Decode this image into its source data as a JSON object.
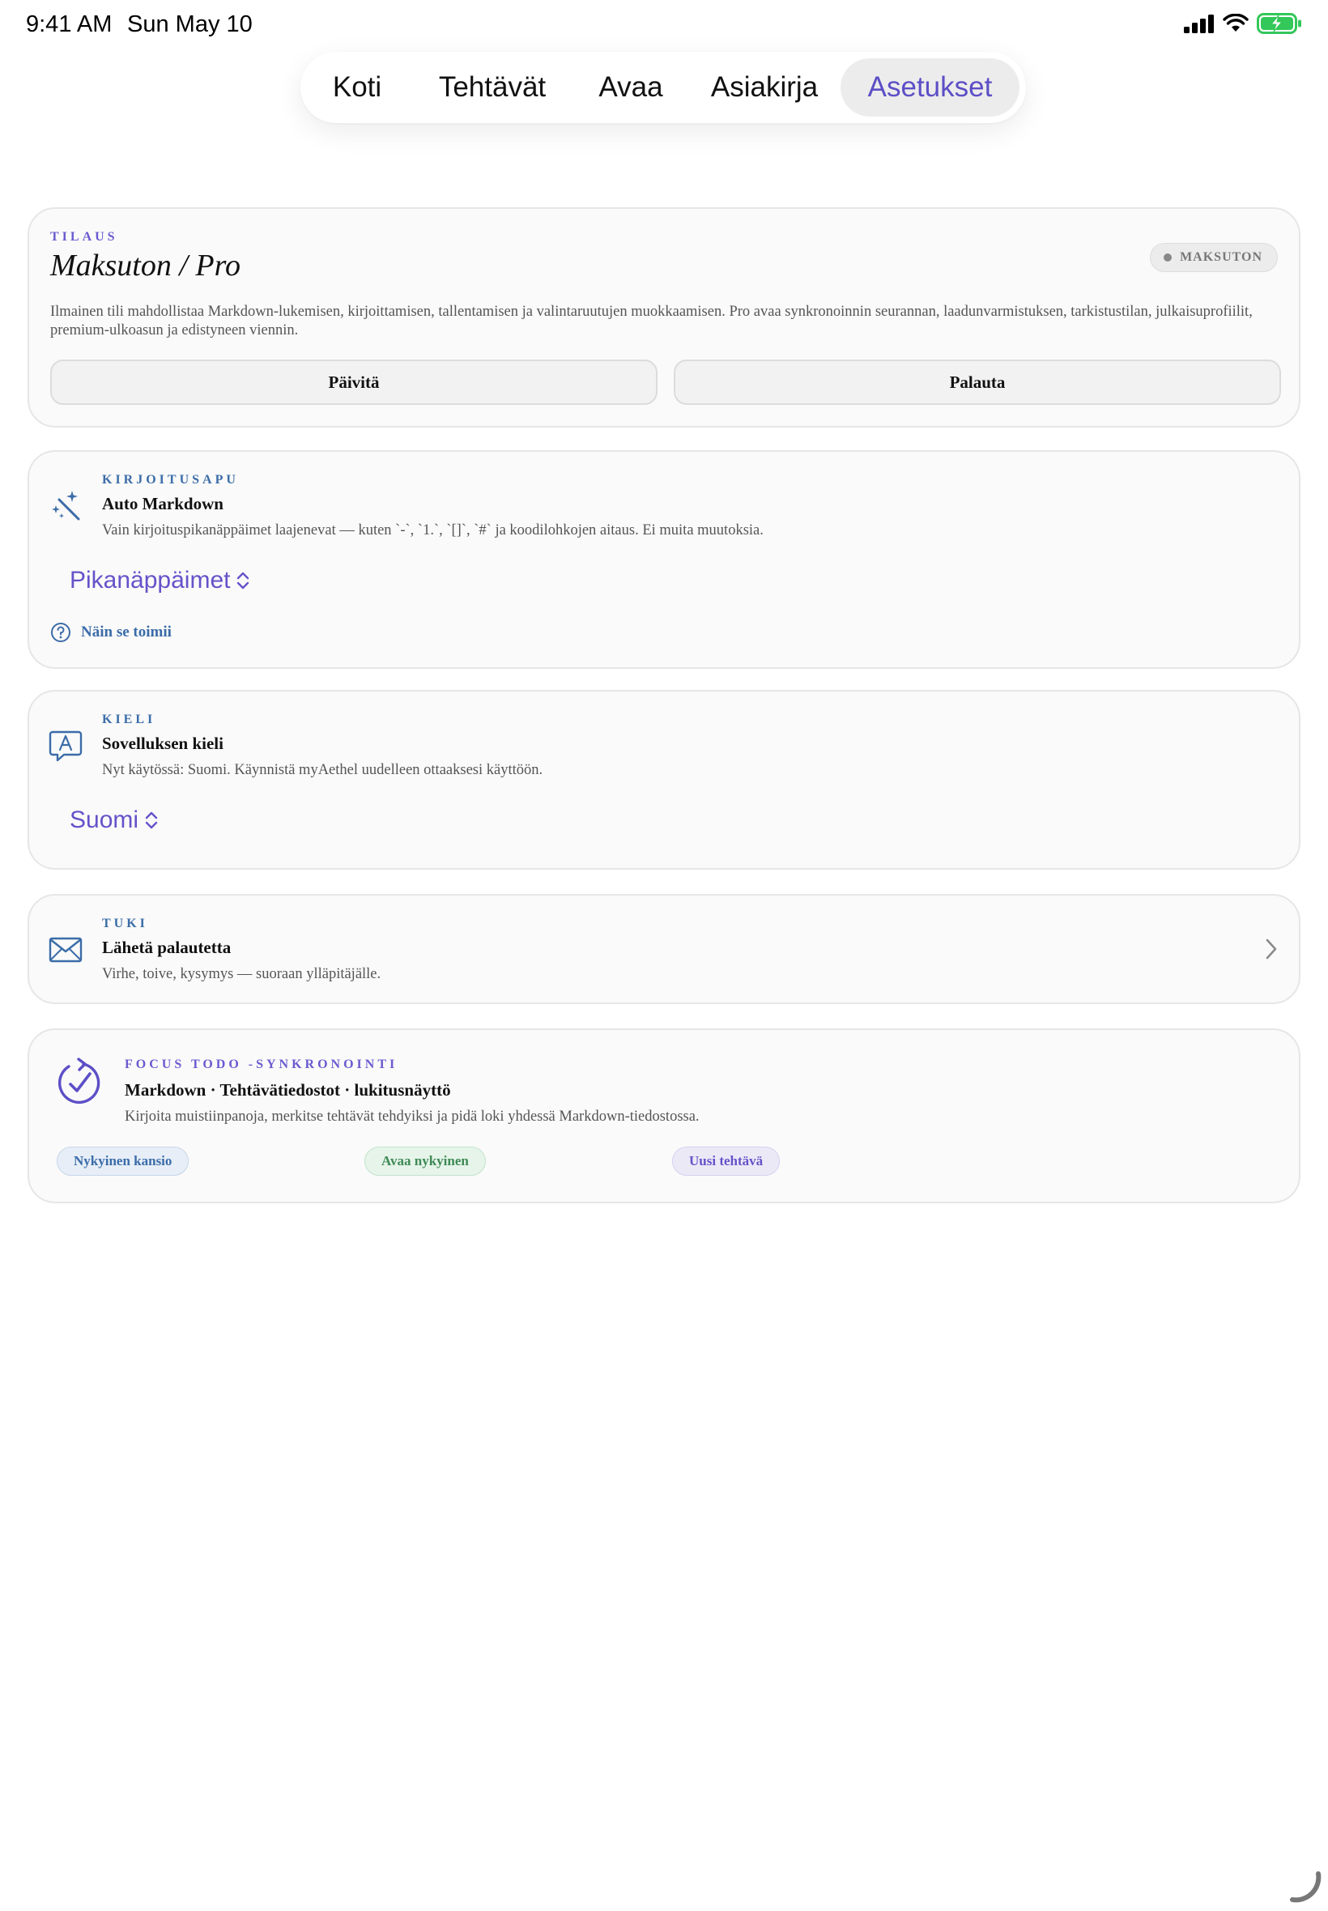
{
  "status": {
    "time": "9:41 AM",
    "date": "Sun May 10"
  },
  "tabs": [
    {
      "label": "Koti",
      "active": false
    },
    {
      "label": "Tehtävät",
      "active": false
    },
    {
      "label": "Avaa",
      "active": false
    },
    {
      "label": "Asiakirja",
      "active": false
    },
    {
      "label": "Asetukset",
      "active": true
    }
  ],
  "subscription": {
    "eyebrow": "TILAUS",
    "title": "Maksuton / Pro",
    "badge": "MAKSUTON",
    "description": "Ilmainen tili mahdollistaa Markdown-lukemisen, kirjoittamisen, tallentamisen ja valintaruutujen muokkaamisen. Pro avaa synkronoinnin seurannan, laadunvarmistuksen, tarkistustilan, julkaisuprofiilit, premium-ulkoasun ja edistyneen viennin.",
    "upgrade_label": "Päivitä",
    "restore_label": "Palauta"
  },
  "writing": {
    "eyebrow": "KIRJOITUSAPU",
    "title": "Auto Markdown",
    "description": "Vain kirjoituspikanäppäimet laajenevat — kuten `-`, `1.`, `[]`, `#` ja koodilohkojen aitaus. Ei muita muutoksia.",
    "picker_value": "Pikanäppäimet",
    "help_label": "Näin se toimii"
  },
  "language": {
    "eyebrow": "KIELI",
    "title": "Sovelluksen kieli",
    "description": "Nyt käytössä: Suomi. Käynnistä myAethel uudelleen ottaaksesi käyttöön.",
    "picker_value": "Suomi"
  },
  "support": {
    "eyebrow": "TUKI",
    "title": "Lähetä palautetta",
    "description": "Virhe, toive, kysymys — suoraan ylläpitäjälle."
  },
  "focus": {
    "eyebrow": "FOCUS TODO -SYNKRONOINTI",
    "title": "Markdown · Tehtävätiedostot · lukitusnäyttö",
    "description": "Kirjoita muistiinpanoja, merkitse tehtävät tehdyiksi ja pidä loki yhdessä Markdown-tiedostossa.",
    "chips": [
      "Nykyinen kansio",
      "Avaa nykyinen",
      "Uusi tehtävä"
    ]
  },
  "colors": {
    "accent": "#5c4fc6",
    "link_blue": "#3b6ca8",
    "battery_green": "#34c759"
  }
}
